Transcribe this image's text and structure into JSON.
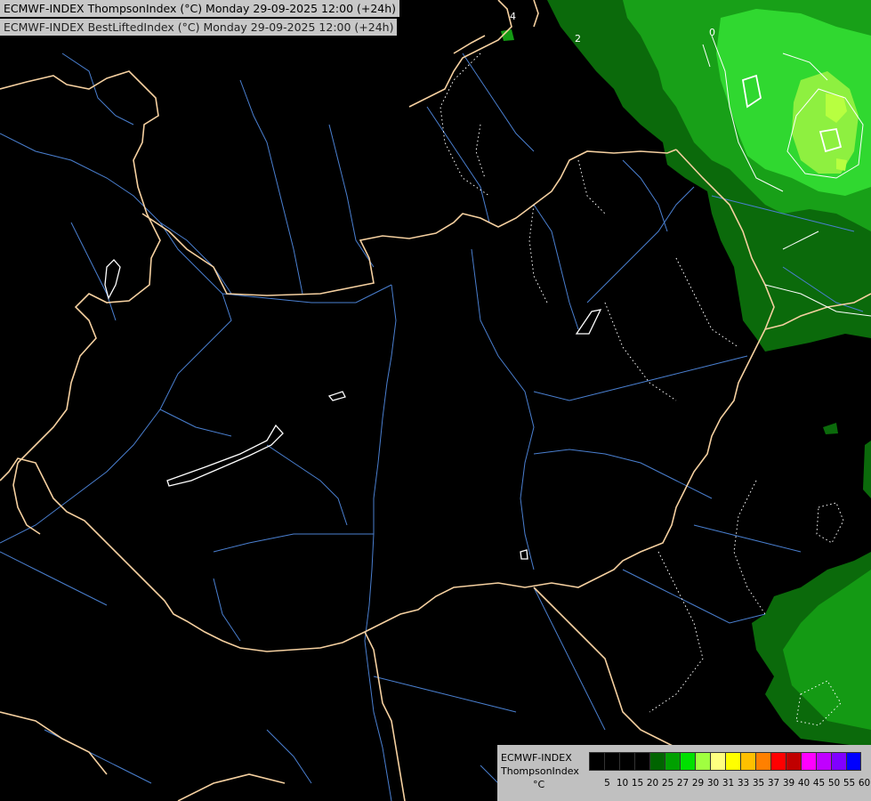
{
  "header": {
    "line1": "ECMWF-INDEX ThompsonIndex (°C) Monday 29-09-2025 12:00 (+24h)",
    "line2": "ECMWF-INDEX BestLiftedIndex (°C) Monday 29-09-2025 12:00 (+24h)"
  },
  "legend": {
    "line1": "ECMWF-INDEX",
    "line2": "ThompsonIndex",
    "unit": "°C",
    "ticks": [
      "5",
      "10",
      "15",
      "20",
      "25",
      "27",
      "29",
      "30",
      "31",
      "33",
      "35",
      "37",
      "39",
      "40",
      "45",
      "50",
      "55",
      "60"
    ],
    "colors": [
      "#000000",
      "#000000",
      "#000000",
      "#000000",
      "#006400",
      "#00a000",
      "#00e000",
      "#a0ff40",
      "#ffff80",
      "#ffff00",
      "#ffc000",
      "#ff8000",
      "#ff0000",
      "#c00000",
      "#ff00ff",
      "#c000ff",
      "#8000ff",
      "#0000ff"
    ]
  },
  "contour_labels": [
    "4",
    "2",
    "0"
  ],
  "colors": {
    "border": "#f5d0a0",
    "river": "#4a7fd0",
    "ti_20_25": "#0a6a0a",
    "ti_25_27": "#149a14",
    "ti_27_29": "#2dd02d",
    "ti_29_30": "#8af040",
    "contour": "#ffffff"
  }
}
